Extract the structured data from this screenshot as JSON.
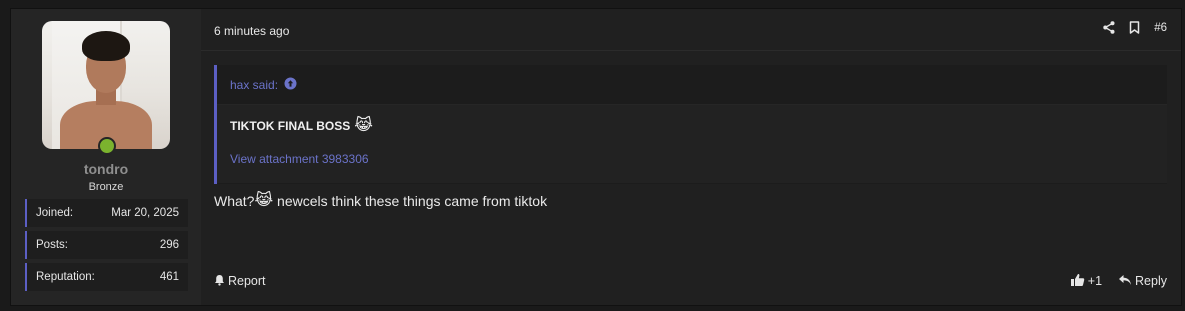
{
  "user": {
    "username": "tondro",
    "title": "Bronze",
    "online": true,
    "stats": [
      {
        "label": "Joined:",
        "value": "Mar 20, 2025"
      },
      {
        "label": "Posts:",
        "value": "296"
      },
      {
        "label": "Reputation:",
        "value": "461"
      }
    ]
  },
  "post": {
    "timestamp": "6 minutes ago",
    "number": "#6",
    "quote": {
      "author": "hax said:",
      "text": "TIKTOK FINAL BOSS",
      "emoji": "😹",
      "attachment_link": "View attachment 3983306"
    },
    "message": {
      "prefix": "What?",
      "emoji": "😹",
      "suffix": " newcels think these things came from tiktok"
    }
  },
  "footer": {
    "report_label": "Report",
    "like_count": "+1",
    "reply_label": "Reply"
  },
  "colors": {
    "accent": "#5c5fc4",
    "link": "#6b73c9",
    "online": "#7bb32e",
    "background": "#1a1a1a"
  },
  "icons": {
    "share": "share-icon",
    "bookmark": "bookmark-icon",
    "arrow_up": "arrow-up-circle-icon",
    "report": "bell-icon",
    "like": "thumbs-up-icon",
    "reply": "reply-icon"
  }
}
